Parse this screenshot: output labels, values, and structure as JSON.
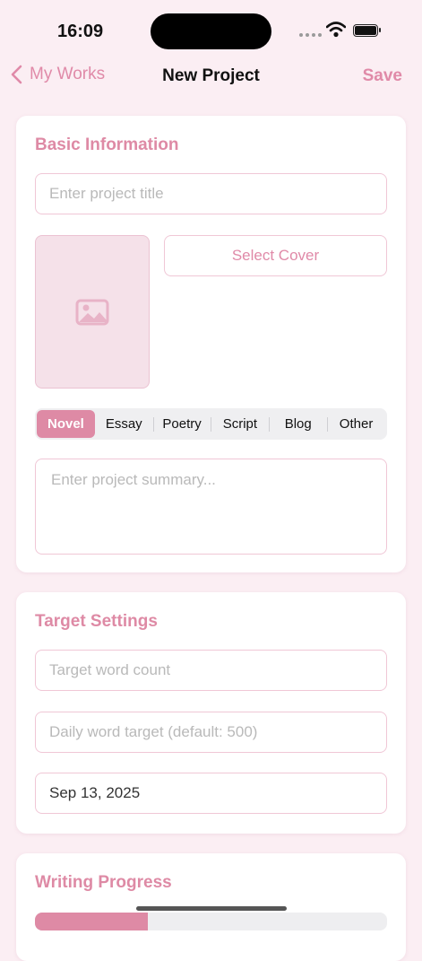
{
  "status_bar": {
    "time": "16:09"
  },
  "nav": {
    "back_label": "My Works",
    "title": "New Project",
    "save_label": "Save"
  },
  "basic_info": {
    "title": "Basic Information",
    "project_title_placeholder": "Enter project title",
    "select_cover_label": "Select Cover",
    "cover_icon": "image-placeholder-icon",
    "types": [
      "Novel",
      "Essay",
      "Poetry",
      "Script",
      "Blog",
      "Other"
    ],
    "selected_type": "Novel",
    "summary_placeholder": "Enter project summary..."
  },
  "target_settings": {
    "title": "Target Settings",
    "word_count_placeholder": "Target word count",
    "daily_target_placeholder": "Daily word target (default: 500)",
    "date_value": "Sep 13, 2025"
  },
  "writing_progress": {
    "title": "Writing Progress",
    "progress_fraction": 0.32
  },
  "colors": {
    "accent": "#de8aa5",
    "background": "#fbeef3",
    "border": "#f0c7d6"
  }
}
